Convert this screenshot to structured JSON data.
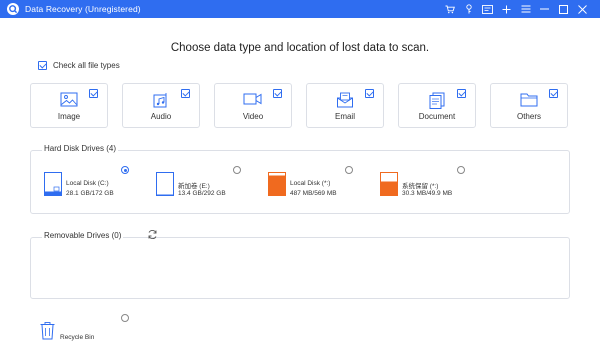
{
  "window": {
    "title": "Data Recovery (Unregistered)"
  },
  "titlebar_icons": [
    "cart-icon",
    "key-icon",
    "feedback-icon",
    "plus-icon",
    "menu-icon",
    "minimize-icon",
    "close-icon"
  ],
  "heading": "Choose data type and location of lost data to scan.",
  "check_all": {
    "label": "Check all file types",
    "checked": true
  },
  "file_types": [
    {
      "label": "Image",
      "icon": "image-icon",
      "checked": true
    },
    {
      "label": "Audio",
      "icon": "audio-icon",
      "checked": true
    },
    {
      "label": "Video",
      "icon": "video-icon",
      "checked": true
    },
    {
      "label": "Email",
      "icon": "email-icon",
      "checked": true
    },
    {
      "label": "Document",
      "icon": "document-icon",
      "checked": true
    },
    {
      "label": "Others",
      "icon": "folder-icon",
      "checked": true
    }
  ],
  "hard_disk": {
    "title": "Hard Disk Drives (4)",
    "drives": [
      {
        "name": "Local Disk (C:)",
        "size": "28.1 GB/172 GB",
        "selected": true,
        "color": "#2f6df0",
        "fill": 0.16
      },
      {
        "name": "新加卷 (E:)",
        "size": "13.4 GB/292 GB",
        "selected": false,
        "color": "#2f6df0",
        "fill": 0.05
      },
      {
        "name": "Local Disk (*:)",
        "size": "487 MB/569 MB",
        "selected": false,
        "color": "#f06a1f",
        "fill": 0.86
      },
      {
        "name": "系统保留 (*:)",
        "size": "30.3 MB/49.9 MB",
        "selected": false,
        "color": "#f06a1f",
        "fill": 0.61
      }
    ]
  },
  "removable": {
    "title": "Removable Drives (0)"
  },
  "recycle_bin": {
    "label": "Recycle Bin",
    "selected": false
  },
  "accent_color": "#2f6df0"
}
